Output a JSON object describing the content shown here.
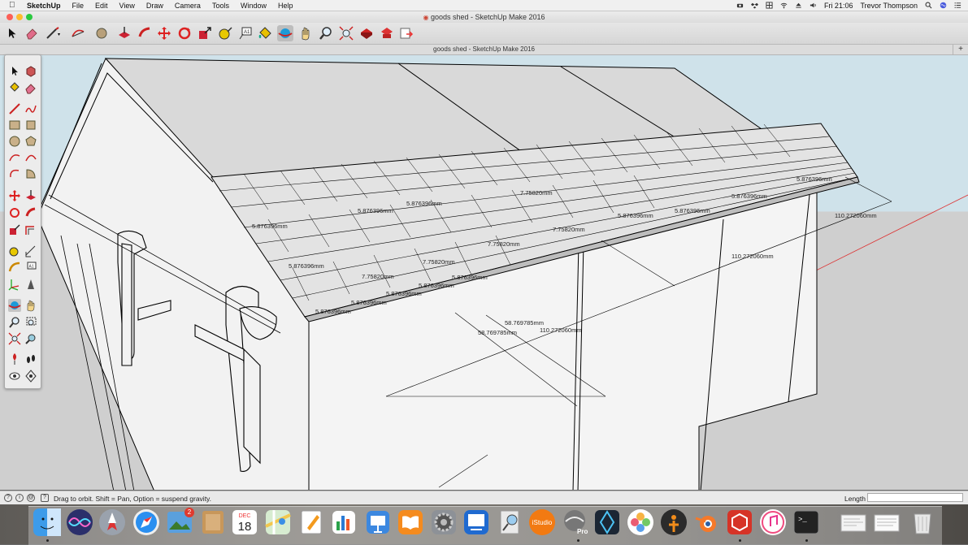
{
  "menubar": {
    "app_name": "SketchUp",
    "items": [
      "File",
      "Edit",
      "View",
      "Draw",
      "Camera",
      "Tools",
      "Window",
      "Help"
    ],
    "clock": "Fri 21:06",
    "user": "Trevor Thompson"
  },
  "window": {
    "title": "goods shed - SketchUp Make 2016",
    "tab_title": "goods shed - SketchUp Make 2016",
    "tab_add": "+"
  },
  "toolbar": {
    "icons": [
      "select-icon",
      "eraser-icon",
      "line-icon",
      "arc-icon",
      "shapes-icon",
      "push-pull-icon",
      "follow-me-icon",
      "move-icon",
      "rotate-icon",
      "scale-icon",
      "tape-measure-icon",
      "text-icon",
      "paint-bucket-icon",
      "orbit-icon",
      "pan-icon",
      "zoom-icon",
      "zoom-extents-icon",
      "warehouse-icon",
      "extension-warehouse-icon",
      "send-to-layout-icon"
    ]
  },
  "dimensions": {
    "d1": "110.272060mm",
    "d2": "110.272060mm",
    "d3": "110.272060mm",
    "d4": "58.769785mm",
    "d5": "58.769785mm",
    "slate_a": "5.876396mm",
    "slate_b": "7.75820mm"
  },
  "statusbar": {
    "hint": "Drag to orbit.  Shift = Pan, Option = suspend gravity.",
    "length_label": "Length",
    "length_value": ""
  },
  "dock": {
    "calendar_month": "DEC",
    "calendar_day": "18",
    "notification_badge": "2",
    "istudio_label": "iStudio",
    "pro_label": "Pro"
  },
  "colors": {
    "menubar": "#f0f0f0",
    "sky": "#cfe2ea",
    "ground": "#cfcfcf",
    "model_face": "#f2f2f2",
    "roof_shadow": "#d9d9d9",
    "edge": "#000000"
  }
}
